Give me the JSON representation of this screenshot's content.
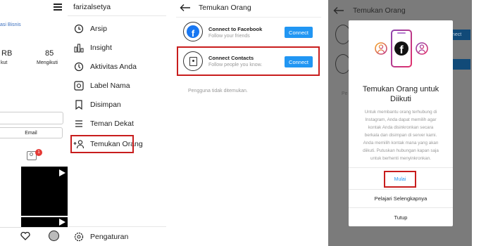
{
  "panel1": {
    "username": "farizalsetya",
    "left_link": "asi Bisnis",
    "stats": {
      "value1": "RB",
      "label1": "kut",
      "value2": "85",
      "label2": "Mengikuti"
    },
    "email_button": "Email",
    "notif_badge": "1",
    "menu": [
      "Arsip",
      "Insight",
      "Aktivitas Anda",
      "Label Nama",
      "Disimpan",
      "Teman Dekat",
      "Temukan Orang"
    ],
    "settings_label": "Pengaturan"
  },
  "panel2": {
    "title": "Temukan Orang",
    "facebook": {
      "title": "Connect to Facebook",
      "subtitle": "Follow your friends",
      "button": "Connect"
    },
    "contacts": {
      "title": "Connect Contacts",
      "subtitle": "Follow people you know.",
      "button": "Connect"
    },
    "empty_text": "Pengguna tidak ditemukan."
  },
  "panel3": {
    "title": "Temukan Orang",
    "bg_button": "nect",
    "bg_text": "Pe",
    "dialog": {
      "heading_line1": "Temukan Orang untuk",
      "heading_line2": "Diikuti",
      "body_lines": [
        "Untuk membantu orang terhubung di",
        "Instagram, Anda dapat memilih agar",
        "kontak Anda disinkronkan secara",
        "berkala dan disimpan di server kami.",
        "Anda memilih kontak mana yang akan",
        "diikuti. Putuskan hubungan kapan saja",
        "untuk berhenti menyinkronkan."
      ],
      "start": "Mulai",
      "learn_more": "Pelajari Selengkapnya",
      "close": "Tutup"
    }
  },
  "colors": {
    "accent": "#2196f3",
    "highlight": "#c81d1d",
    "overlay": "#7b7b7b"
  }
}
